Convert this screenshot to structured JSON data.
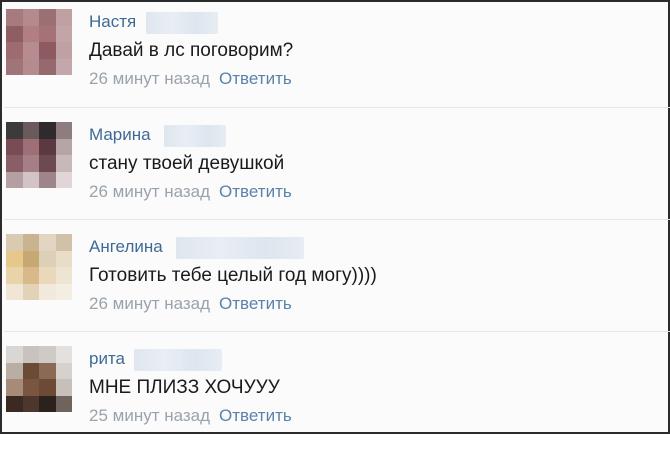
{
  "comments": [
    {
      "author": "Настя",
      "text": "Давай в лс поговорим?",
      "time": "26 минут назад",
      "reply_label": "Ответить",
      "avatar_colors": [
        "#a67a7e",
        "#b58a8e",
        "#9b6f74",
        "#c0a0a3",
        "#8f5e63",
        "#b07e83",
        "#a57277",
        "#c2a5a7",
        "#9e6c70",
        "#b78c90",
        "#8c5a60",
        "#bfa1a4",
        "#a07579",
        "#b48b8f",
        "#96696e",
        "#c4a7aa"
      ]
    },
    {
      "author": "Марина",
      "text": "стану твоей девушкой",
      "time": "26 минут назад",
      "reply_label": "Ответить",
      "avatar_colors": [
        "#3d3a3b",
        "#6b5a5c",
        "#2f2a2c",
        "#8e7d7f",
        "#7b4b55",
        "#9e6f76",
        "#5a3a40",
        "#b7a4a7",
        "#8a5e66",
        "#a57f86",
        "#6c4a50",
        "#c7b8ba",
        "#b49fa3",
        "#d2c3c6",
        "#9d8589",
        "#e0d6d8"
      ]
    },
    {
      "author": "Ангелина",
      "text": "Готовить тебе целый год могу))))",
      "time": "26 минут назад",
      "reply_label": "Ответить",
      "avatar_colors": [
        "#d8cbb2",
        "#c9b48f",
        "#e2d6c2",
        "#d1c1a8",
        "#e6c98a",
        "#c7a772",
        "#ddd0b9",
        "#e8ddc8",
        "#e9d3a8",
        "#d9b98a",
        "#ead8bb",
        "#eee4d2",
        "#efe6d6",
        "#e2d2b8",
        "#f1e9dc",
        "#f3ede2"
      ]
    },
    {
      "author": "рита",
      "text": "МНЕ ПЛИЗЗ ХОЧУУУ",
      "time": "25 минут назад",
      "reply_label": "Ответить",
      "avatar_colors": [
        "#d9d6d4",
        "#c9c3bf",
        "#cfcac6",
        "#e3e0de",
        "#b9ada4",
        "#6b4a36",
        "#8a6a55",
        "#d6d1cd",
        "#a58b78",
        "#7a5540",
        "#6d4a36",
        "#c7bfb9",
        "#3a2a22",
        "#4b372c",
        "#2c221d",
        "#6f635d"
      ]
    }
  ]
}
